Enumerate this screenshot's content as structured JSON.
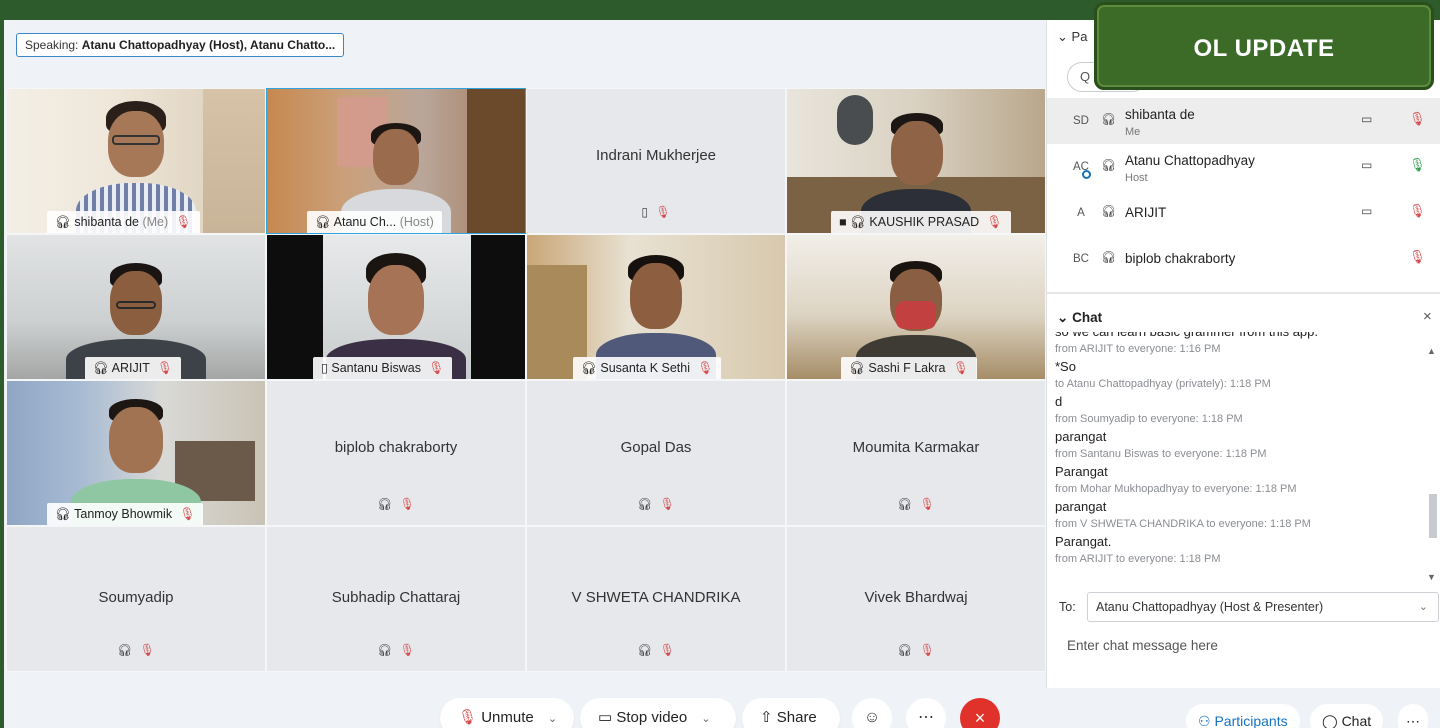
{
  "speaking": {
    "label": "Speaking:",
    "names": "Atanu Chattopadhyay (Host), Atanu Chatto..."
  },
  "tiles": [
    {
      "name": "shibanta de",
      "suffix": "(Me)"
    },
    {
      "name": "Atanu Ch...",
      "suffix": "(Host)"
    },
    {
      "name": "Indrani Mukherjee"
    },
    {
      "name": "KAUSHIK PRASAD"
    },
    {
      "name": "ARIJIT"
    },
    {
      "name": "Santanu Biswas"
    },
    {
      "name": "Susanta K Sethi"
    },
    {
      "name": "Sashi F Lakra"
    },
    {
      "name": "Tanmoy Bhowmik"
    },
    {
      "name": "biplob chakraborty"
    },
    {
      "name": "Gopal Das"
    },
    {
      "name": "Moumita Karmakar"
    },
    {
      "name": "Soumyadip"
    },
    {
      "name": "Subhadip Chattaraj"
    },
    {
      "name": "V SHWETA CHANDRIKA"
    },
    {
      "name": "Vivek Bhardwaj"
    }
  ],
  "participants": {
    "header": "Pa",
    "search_placeholder": "Q",
    "list": [
      {
        "initials": "SD",
        "name": "shibanta de",
        "role": "Me"
      },
      {
        "initials": "AC",
        "name": "Atanu Chattopadhyay",
        "role": "Host"
      },
      {
        "initials": "A",
        "name": "ARIJIT"
      },
      {
        "initials": "BC",
        "name": "biplob chakraborty"
      }
    ]
  },
  "chat": {
    "header": "Chat",
    "messages": [
      {
        "text": "so we can learn basic grammer from this app.",
        "meta": "from ARIJIT to everyone:   1:16 PM"
      },
      {
        "text": "*So",
        "meta": "to Atanu Chattopadhyay (privately):   1:18 PM"
      },
      {
        "text": "d",
        "meta": "from Soumyadip to everyone:   1:18 PM"
      },
      {
        "text": "parangat",
        "meta": "from Santanu Biswas to everyone:   1:18 PM"
      },
      {
        "text": "Parangat",
        "meta": "from Mohar Mukhopadhyay to everyone:   1:18 PM"
      },
      {
        "text": "parangat",
        "meta": "from V SHWETA CHANDRIKA to everyone:   1:18 PM"
      },
      {
        "text": "Parangat.",
        "meta": "from ARIJIT to everyone:   1:18 PM"
      }
    ],
    "to_label": "To:",
    "to_value": "Atanu Chattopadhyay (Host & Presenter)",
    "input_placeholder": "Enter chat message here"
  },
  "badge": {
    "text": "OL UPDATE"
  },
  "toolbar": {
    "unmute": "Unmute",
    "stop_video": "Stop video",
    "share": "Share",
    "participants": "Participants",
    "chat": "Chat"
  }
}
